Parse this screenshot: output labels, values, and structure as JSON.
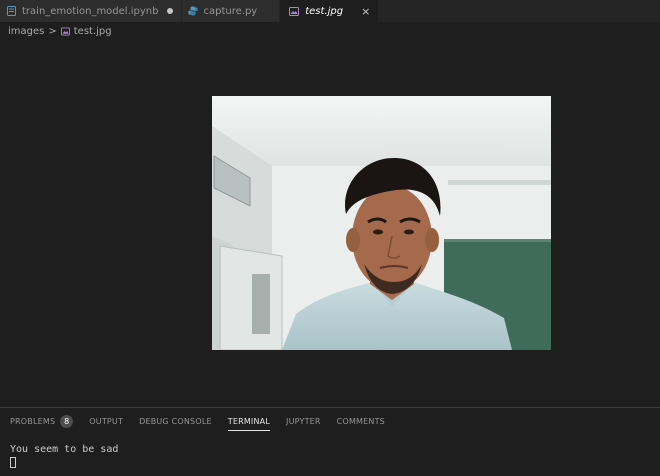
{
  "tabs": [
    {
      "label": "train_emotion_model.ipynb",
      "icon": "notebook-icon",
      "modified": true,
      "active": false
    },
    {
      "label": "capture.py",
      "icon": "python-icon",
      "modified": false,
      "active": false
    },
    {
      "label": "test.jpg",
      "icon": "image-icon",
      "modified": false,
      "active": true
    }
  ],
  "tab_close_glyph": "×",
  "breadcrumb": {
    "folder": "images",
    "separator": ">",
    "file": "test.jpg"
  },
  "panel": {
    "tabs": [
      "PROBLEMS",
      "OUTPUT",
      "DEBUG CONSOLE",
      "TERMINAL",
      "JUPYTER",
      "COMMENTS"
    ],
    "active_tab": "TERMINAL",
    "problems_count": "8"
  },
  "terminal": {
    "output": "You seem to be sad"
  },
  "colors": {
    "editor_bg": "#1e1e1e",
    "tabbar_bg": "#252526",
    "image_icon": "#b180d7",
    "python_icon": "#519aba"
  }
}
